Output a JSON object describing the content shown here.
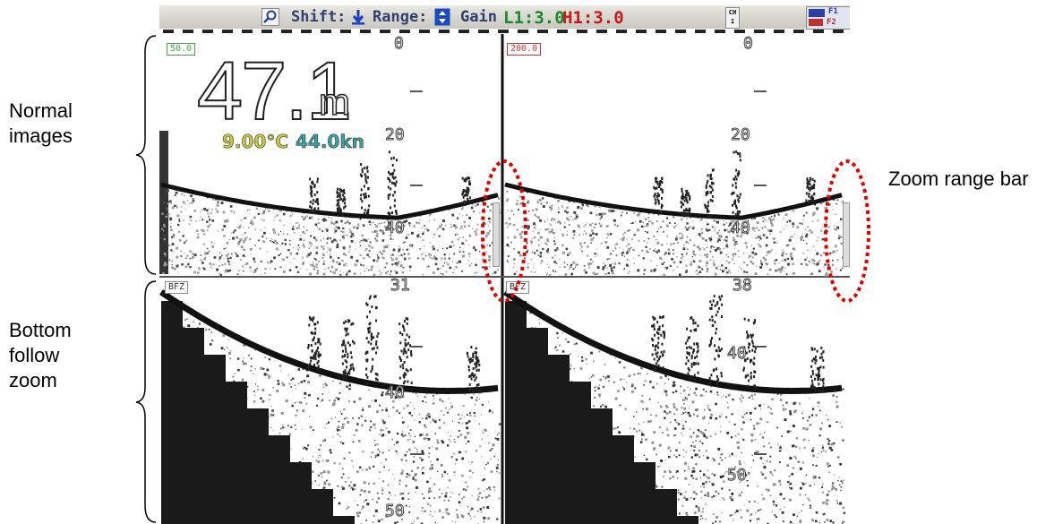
{
  "annotations": {
    "normal_images": "Normal images",
    "bottom_follow_zoom": "Bottom follow zoom",
    "zoom_range_bar": "Zoom range bar"
  },
  "topbar": {
    "shift_label": "Shift:",
    "range_label": "Range:",
    "gain_label": "Gain",
    "l1_gain": "L1:3.0",
    "h1_gain": "H1:3.0",
    "ch_label": "CH 1",
    "f1_label": "F1",
    "f2_label": "F2"
  },
  "panels": {
    "top_left_range_tag": "50.0",
    "top_right_range_tag": "200.0",
    "bottom_left_tag": "BFZ",
    "bottom_right_tag": "BFZ"
  },
  "readouts": {
    "depth_value": "47.1",
    "depth_unit": "m",
    "water_temp": "9.00°C",
    "speed": "44.0kn"
  },
  "depth_scales": {
    "top_left": [
      "0",
      "20",
      "40"
    ],
    "top_right": [
      "0",
      "20",
      "40"
    ],
    "bottom_left": [
      "31",
      "40",
      "50"
    ],
    "bottom_right": [
      "38",
      "40",
      "50"
    ]
  },
  "colors": {
    "frequency_left_frame": "#4aa04a",
    "frequency_right_frame": "#cc3333",
    "gain_low": "#1a8a2a",
    "gain_high": "#c81818",
    "temp_color": "#c8c840",
    "speed_color": "#3aa0a0",
    "highlight_dash": "#e00000"
  }
}
